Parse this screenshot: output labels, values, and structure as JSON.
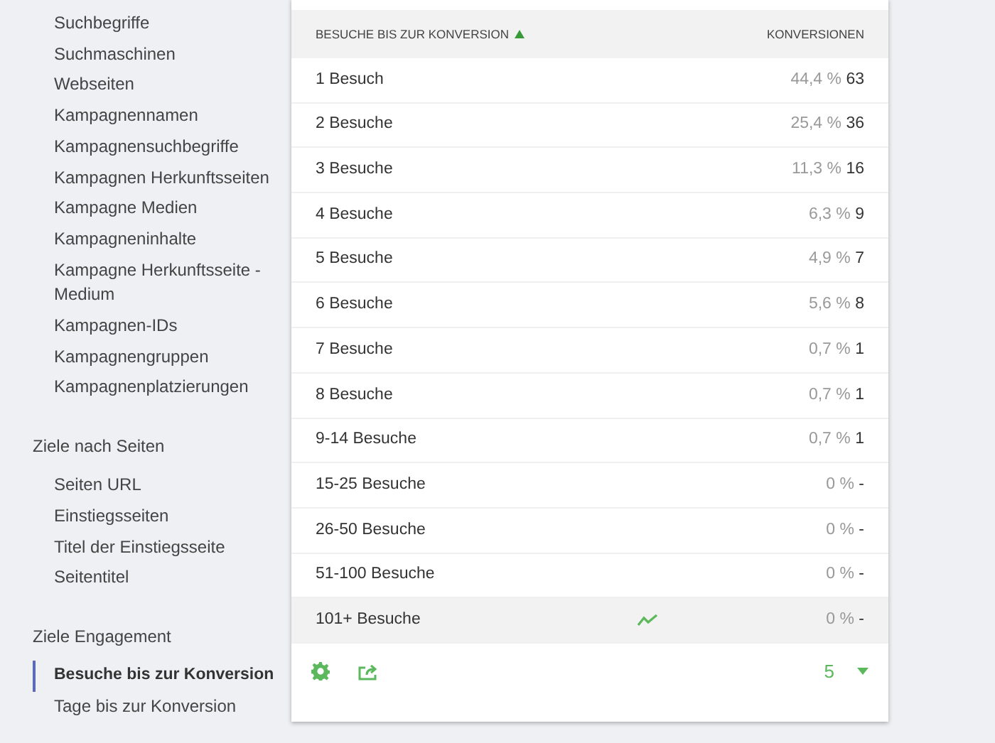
{
  "sidebar": {
    "groups": [
      {
        "items": [
          {
            "label": "Suchbegriffe",
            "selected": false
          },
          {
            "label": "Suchmaschinen",
            "selected": false
          },
          {
            "label": "Webseiten",
            "selected": false
          },
          {
            "label": "Kampagnennamen",
            "selected": false
          },
          {
            "label": "Kampagnensuchbegriffe",
            "selected": false
          },
          {
            "label": "Kampagnen Herkunftsseiten",
            "selected": false
          },
          {
            "label": "Kampagne Medien",
            "selected": false
          },
          {
            "label": "Kampagneninhalte",
            "selected": false
          },
          {
            "label": "Kampagne Herkunftsseite - Medium",
            "selected": false
          },
          {
            "label": "Kampagnen-IDs",
            "selected": false
          },
          {
            "label": "Kampagnengruppen",
            "selected": false
          },
          {
            "label": "Kampagnenplatzierungen",
            "selected": false
          }
        ]
      },
      {
        "title": "Ziele nach Seiten",
        "items": [
          {
            "label": "Seiten URL",
            "selected": false
          },
          {
            "label": "Einstiegsseiten",
            "selected": false
          },
          {
            "label": "Titel der Einstiegsseite",
            "selected": false
          },
          {
            "label": "Seitentitel",
            "selected": false
          }
        ]
      },
      {
        "title": "Ziele Engagement",
        "items": [
          {
            "label": "Besuche bis zur Konversion",
            "selected": true
          },
          {
            "label": "Tage bis zur Konversion",
            "selected": false
          }
        ]
      }
    ]
  },
  "table": {
    "columns": [
      {
        "label": "BESUCHE BIS ZUR KONVERSION",
        "sorted": true
      },
      {
        "label": "KONVERSIONEN",
        "sorted": false
      }
    ],
    "rows": [
      {
        "label": "1 Besuch",
        "percent": "44,4 %",
        "count": "63",
        "hovered": false
      },
      {
        "label": "2 Besuche",
        "percent": "25,4 %",
        "count": "36",
        "hovered": false
      },
      {
        "label": "3 Besuche",
        "percent": "11,3 %",
        "count": "16",
        "hovered": false
      },
      {
        "label": "4 Besuche",
        "percent": "6,3 %",
        "count": "9",
        "hovered": false
      },
      {
        "label": "5 Besuche",
        "percent": "4,9 %",
        "count": "7",
        "hovered": false
      },
      {
        "label": "6 Besuche",
        "percent": "5,6 %",
        "count": "8",
        "hovered": false
      },
      {
        "label": "7 Besuche",
        "percent": "0,7 %",
        "count": "1",
        "hovered": false
      },
      {
        "label": "8 Besuche",
        "percent": "0,7 %",
        "count": "1",
        "hovered": false
      },
      {
        "label": "9-14 Besuche",
        "percent": "0,7 %",
        "count": "1",
        "hovered": false
      },
      {
        "label": "15-25 Besuche",
        "percent": "0 %",
        "count": "-",
        "hovered": false
      },
      {
        "label": "26-50 Besuche",
        "percent": "0 %",
        "count": "-",
        "hovered": false
      },
      {
        "label": "51-100 Besuche",
        "percent": "0 %",
        "count": "-",
        "hovered": false
      },
      {
        "label": "101+ Besuche",
        "percent": "0 %",
        "count": "-",
        "hovered": true
      }
    ],
    "footer": {
      "limit": "5"
    }
  }
}
